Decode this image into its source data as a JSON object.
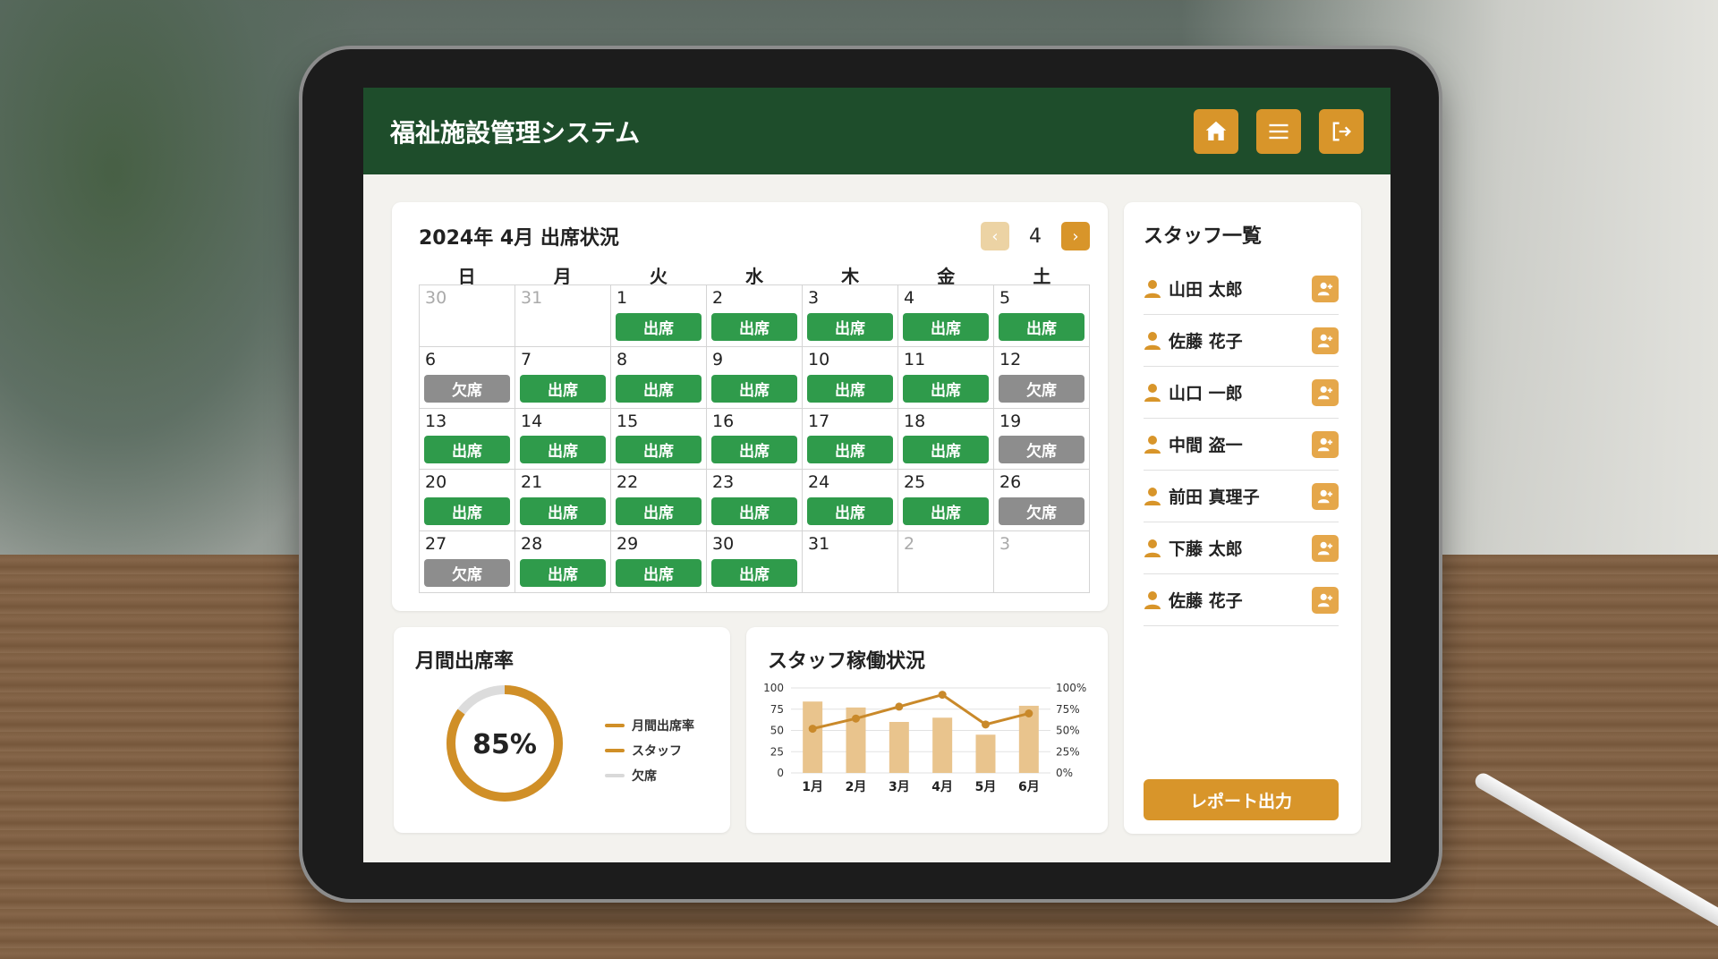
{
  "app": {
    "title": "福祉施設管理システム"
  },
  "calendar": {
    "title": "2024年 4月 出席状況",
    "month_display": "4",
    "prev_label": "‹",
    "next_label": "›",
    "weekdays": [
      "日",
      "月",
      "火",
      "水",
      "木",
      "金",
      "土"
    ],
    "days": [
      {
        "day": "30",
        "muted": true,
        "status": ""
      },
      {
        "day": "31",
        "muted": true,
        "status": ""
      },
      {
        "day": "1",
        "status": "出席"
      },
      {
        "day": "2",
        "status": "出席"
      },
      {
        "day": "3",
        "status": "出席"
      },
      {
        "day": "4",
        "status": "出席"
      },
      {
        "day": "5",
        "status": "出席"
      },
      {
        "day": "6",
        "status": "欠席"
      },
      {
        "day": "7",
        "status": "出席"
      },
      {
        "day": "8",
        "status": "出席"
      },
      {
        "day": "9",
        "status": "出席"
      },
      {
        "day": "10",
        "status": "出席"
      },
      {
        "day": "11",
        "status": "出席"
      },
      {
        "day": "12",
        "status": "欠席"
      },
      {
        "day": "13",
        "status": "出席"
      },
      {
        "day": "14",
        "status": "出席"
      },
      {
        "day": "15",
        "status": "出席"
      },
      {
        "day": "16",
        "status": "出席"
      },
      {
        "day": "17",
        "status": "出席"
      },
      {
        "day": "18",
        "status": "出席"
      },
      {
        "day": "19",
        "status": "欠席"
      },
      {
        "day": "20",
        "status": "出席"
      },
      {
        "day": "21",
        "status": "出席"
      },
      {
        "day": "22",
        "status": "出席"
      },
      {
        "day": "23",
        "status": "出席"
      },
      {
        "day": "24",
        "status": "出席"
      },
      {
        "day": "25",
        "status": "出席"
      },
      {
        "day": "26",
        "status": "欠席"
      },
      {
        "day": "27",
        "status": "欠席"
      },
      {
        "day": "28",
        "status": "出席"
      },
      {
        "day": "29",
        "status": "出席"
      },
      {
        "day": "30",
        "status": "出席"
      },
      {
        "day": "31",
        "status": ""
      },
      {
        "day": "2",
        "muted": true,
        "status": ""
      },
      {
        "day": "3",
        "muted": true,
        "status": ""
      }
    ],
    "present_label": "出席",
    "absent_label": "欠席",
    "colors": {
      "present": "#2f9b4b",
      "absent": "#8d8d8d"
    }
  },
  "monthly_rate": {
    "title": "月間出席率",
    "value_label": "85%",
    "fraction": 0.85,
    "legend": [
      {
        "label": "月間出席率",
        "color": "#d08f27"
      },
      {
        "label": "スタッフ",
        "color": "#d08f27"
      },
      {
        "label": "欠席",
        "color": "#d9d9d9"
      }
    ]
  },
  "staff_chart": {
    "title": "スタッフ稼働状況",
    "chart_data": {
      "type": "bar",
      "categories": [
        "1月",
        "2月",
        "3月",
        "4月",
        "5月",
        "6月"
      ],
      "series": [
        {
          "type": "bar",
          "axis": "left",
          "values": [
            84,
            77,
            60,
            65,
            45,
            79
          ],
          "color": "#e9c48d"
        },
        {
          "type": "line",
          "axis": "right",
          "values": [
            52,
            64,
            78,
            92,
            57,
            70
          ],
          "color": "#c9892a"
        }
      ],
      "left_ticks": [
        "0",
        "25",
        "50",
        "75",
        "100"
      ],
      "right_ticks": [
        "0%",
        "25%",
        "50%",
        "75%",
        "100%"
      ],
      "ylim": [
        0,
        100
      ]
    }
  },
  "staff": {
    "title": "スタッフ一覧",
    "members": [
      "山田 太郎",
      "佐藤 花子",
      "山口 一郎",
      "中間 盗一",
      "前田 真理子",
      "下藤 太郎",
      "佐藤 花子"
    ],
    "report_button": "レポート出力"
  },
  "icons": {
    "home": "home-icon",
    "menu": "menu-icon",
    "logout": "logout-icon",
    "person": "person-icon",
    "add_user": "add-user-icon"
  },
  "colors": {
    "header": "#1e4d2b",
    "accent": "#d8952a"
  }
}
